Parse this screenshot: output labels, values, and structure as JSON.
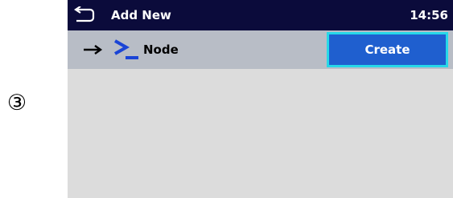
{
  "step_marker": "③",
  "titlebar": {
    "back_icon": "back-arrow-icon",
    "title": "Add New",
    "time": "14:56"
  },
  "row": {
    "arrow_icon": "right-arrow-icon",
    "node_icon": "terminal-prompt-icon",
    "label": "Node"
  },
  "create_button": {
    "label": "Create"
  },
  "colors": {
    "titlebar_bg": "#0b0b3b",
    "row_bg": "#b8bdc6",
    "screen_bg": "#dcdcdc",
    "button_bg": "#1f5fcf",
    "button_border": "#27d8e8",
    "icon_blue": "#1a44d6"
  }
}
